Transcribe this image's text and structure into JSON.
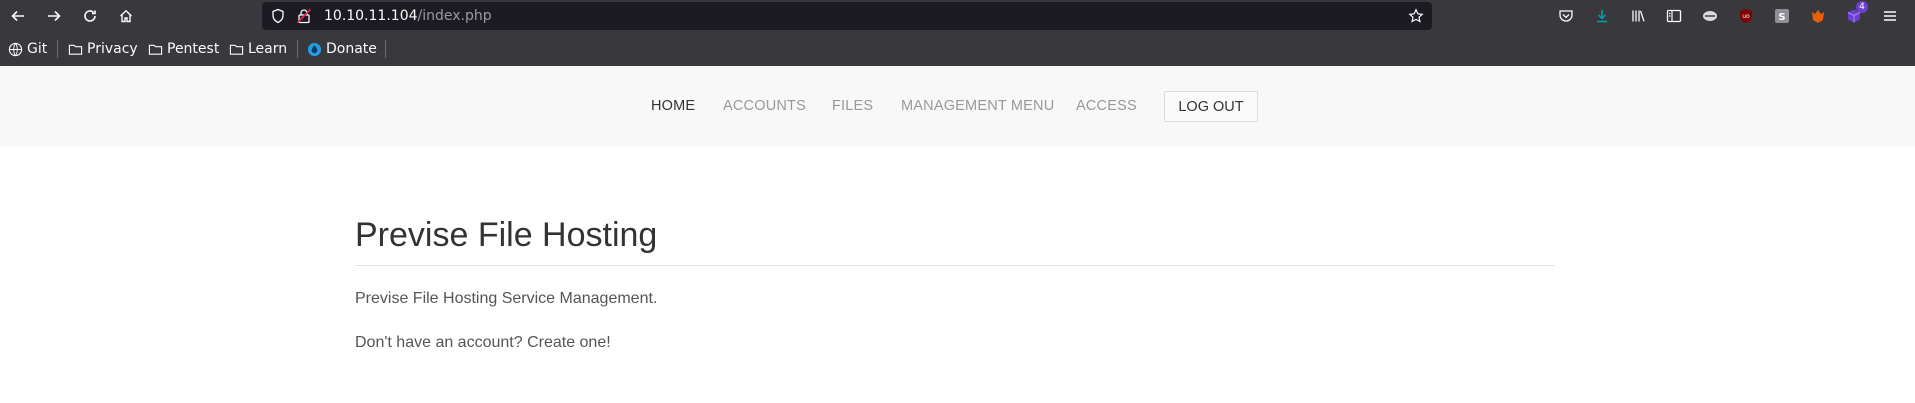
{
  "browser": {
    "url_host": "10.10.11.104",
    "url_path": "/index.php",
    "extension_badge": "4",
    "bookmarks": [
      {
        "label": "Git",
        "icon": "globe-icon"
      },
      {
        "label": "Privacy",
        "icon": "folder-icon"
      },
      {
        "label": "Pentest",
        "icon": "folder-icon"
      },
      {
        "label": "Learn",
        "icon": "folder-icon"
      },
      {
        "label": "Donate",
        "icon": "donate-icon"
      }
    ]
  },
  "nav": {
    "items": [
      "HOME",
      "ACCOUNTS",
      "FILES",
      "MANAGEMENT MENU",
      "ACCESS"
    ],
    "active": "HOME",
    "logout_label": "LOG OUT"
  },
  "main": {
    "title": "Previse File Hosting",
    "description": "Previse File Hosting Service Management.",
    "signup_text": "Don't have an account? Create one!"
  },
  "colors": {
    "chrome_bg": "#38383d",
    "urlbar_bg": "#1c1b22",
    "nav_bg": "#f8f8f8",
    "text_dark": "#333333",
    "text_muted": "#999999"
  }
}
